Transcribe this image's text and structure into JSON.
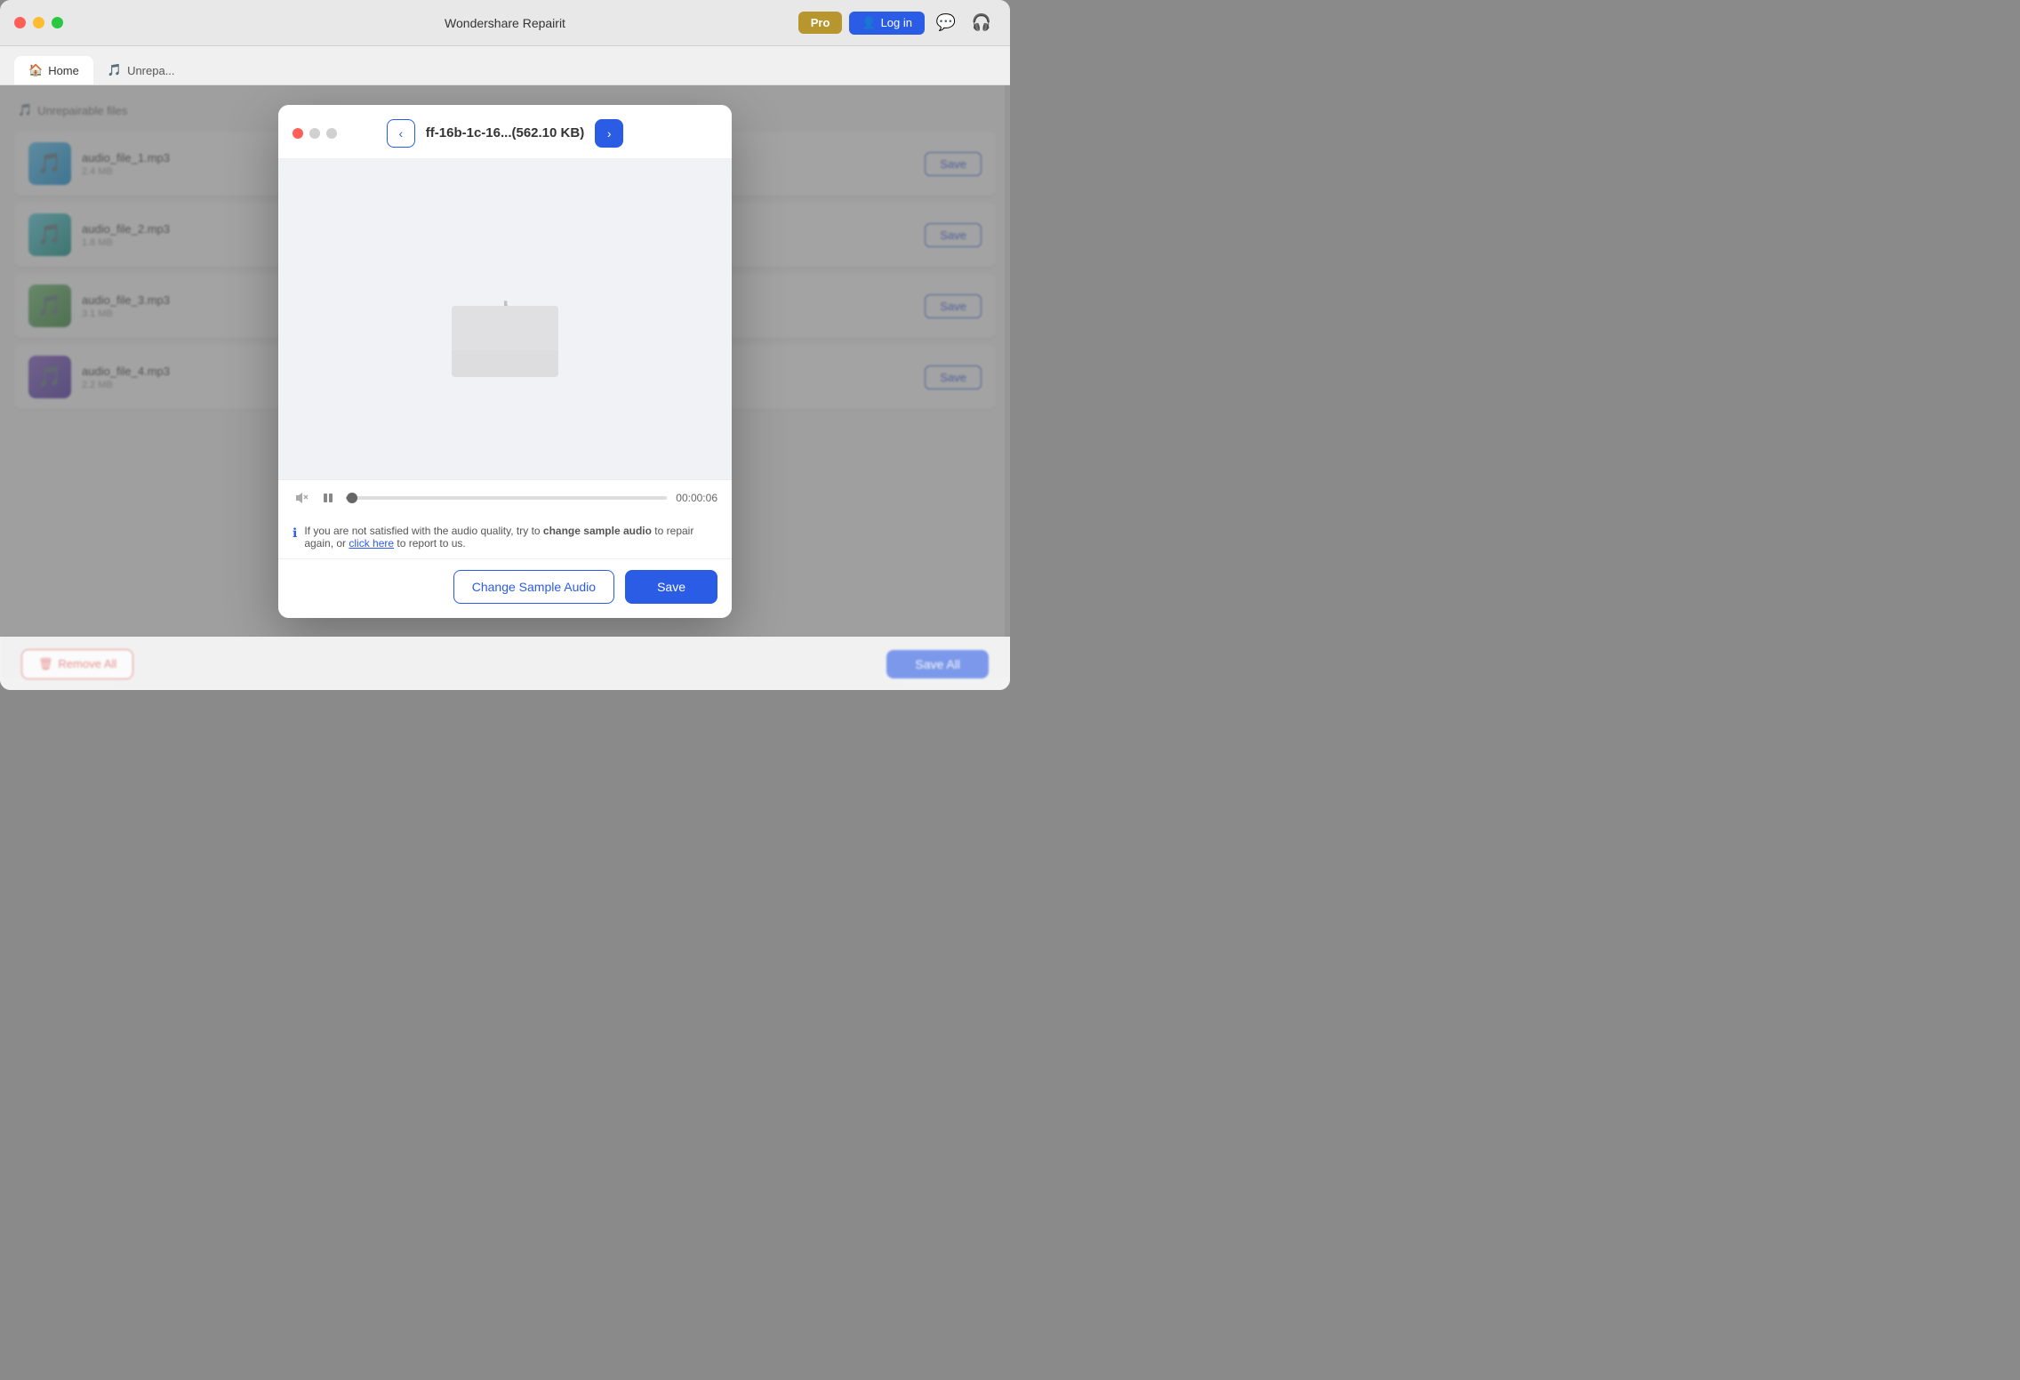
{
  "app": {
    "title": "Wondershare Repairit",
    "pro_label": "Pro",
    "login_label": "Log in"
  },
  "nav": {
    "home_tab": "Home",
    "unrepairable_tab": "Unrepa..."
  },
  "list": {
    "section_title": "Unrepairable files",
    "items": [
      {
        "id": 1,
        "thumb_class": "thumb-blue",
        "name": "audio_file_1.mp3",
        "meta": "2.4 MB",
        "save_label": "Save"
      },
      {
        "id": 2,
        "thumb_class": "thumb-teal",
        "name": "audio_file_2.mp3",
        "meta": "1.8 MB",
        "save_label": "Save"
      },
      {
        "id": 3,
        "thumb_class": "thumb-green",
        "name": "audio_file_3.mp3",
        "meta": "3.1 MB",
        "save_label": "Save"
      },
      {
        "id": 4,
        "thumb_class": "thumb-purple",
        "name": "audio_file_4.mp3",
        "meta": "2.2 MB",
        "save_label": "Save"
      }
    ]
  },
  "bottom_bar": {
    "remove_all_label": "Remove All",
    "save_all_label": "Save All"
  },
  "modal": {
    "filename": "ff-16b-1c-16...(562.10 KB)",
    "prev_btn_label": "‹",
    "next_btn_label": "›",
    "time_display": "00:00:06",
    "info_text_before": "If you are not satisfied with the audio quality, try to ",
    "info_text_bold": "change sample audio",
    "info_text_middle": " to repair again, or ",
    "info_link_text": "click here",
    "info_text_after": " to report to us.",
    "change_sample_btn_label": "Change Sample Audio",
    "save_btn_label": "Save",
    "progress_percent": 2
  }
}
